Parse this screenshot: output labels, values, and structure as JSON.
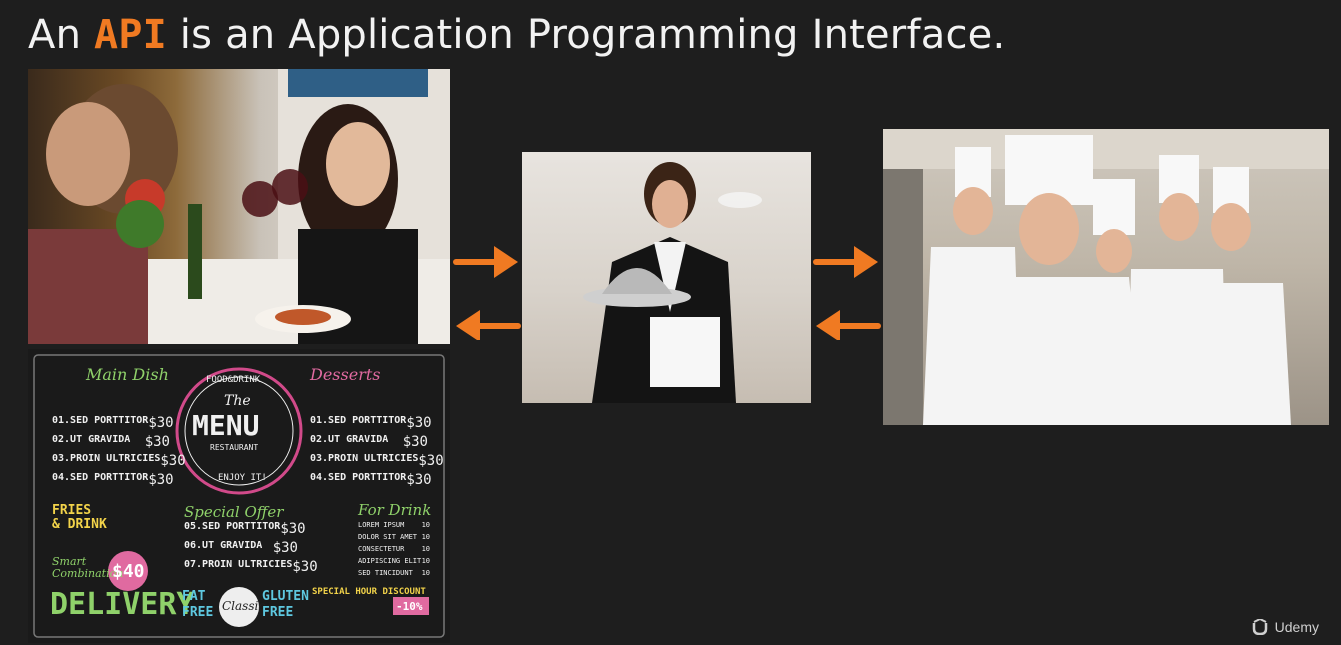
{
  "slide": {
    "title_prefix": "An ",
    "title_highlight": "API",
    "title_suffix": " is an Application Programming Interface."
  },
  "menu": {
    "left_heading": "Main Dish",
    "center_top": "FOOD&DRINK",
    "center_the": "The",
    "center_menu": "MENU",
    "center_restaurant": "RESTAURANT",
    "center_enjoy": "ENJOY IT!",
    "right_heading": "Desserts",
    "left_items": [
      {
        "name": "01.SED PORTTITOR",
        "price": "$30"
      },
      {
        "name": "02.UT GRAVIDA",
        "price": "$30"
      },
      {
        "name": "03.PROIN ULTRICIES",
        "price": "$30"
      },
      {
        "name": "04.SED PORTTITOR",
        "price": "$30"
      }
    ],
    "right_items": [
      {
        "name": "01.SED PORTTITOR",
        "price": "$30"
      },
      {
        "name": "02.UT GRAVIDA",
        "price": "$30"
      },
      {
        "name": "03.PROIN ULTRICIES",
        "price": "$30"
      },
      {
        "name": "04.SED PORTTITOR",
        "price": "$30"
      }
    ],
    "fries_title": "FRIES",
    "fries_title2": "& DRINK",
    "smart": "Smart",
    "combination": "Combination",
    "combo_price": "$40",
    "special_heading": "Special Offer",
    "special_items": [
      {
        "name": "05.SED PORTTITOR",
        "price": "$30"
      },
      {
        "name": "06.UT GRAVIDA",
        "price": "$30"
      },
      {
        "name": "07.PROIN ULTRICIES",
        "price": "$30"
      }
    ],
    "drink_heading": "For Drink",
    "drink_items": [
      {
        "name": "LOREM IPSUM",
        "price": "10"
      },
      {
        "name": "DOLOR SIT AMET",
        "price": "10"
      },
      {
        "name": "CONSECTETUR",
        "price": "10"
      },
      {
        "name": "ADIPISCING ELIT",
        "price": "10"
      },
      {
        "name": "SED TINCIDUNT",
        "price": "10"
      }
    ],
    "delivery": "DELIVERY",
    "fat": "FAT",
    "fat_free": "FREE",
    "classic": "Classic",
    "gluten": "GLUTEN",
    "gluten_free": "FREE",
    "special_hour": "SPECIAL HOUR DISCOUNT",
    "discount": "-10%"
  },
  "brand": {
    "name": "Udemy"
  },
  "colors": {
    "accent": "#f07a22",
    "background": "#1e1e1e"
  }
}
